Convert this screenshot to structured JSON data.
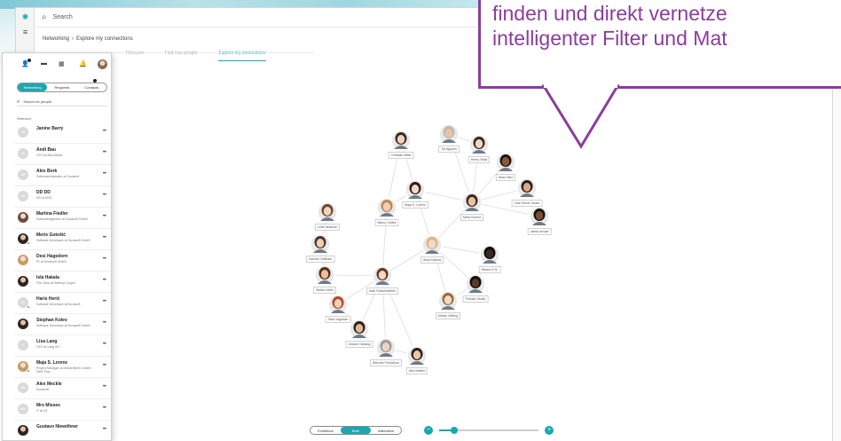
{
  "header": {
    "search_placeholder": "Search",
    "breadcrumb": [
      "Networking",
      "Explore my connections"
    ],
    "tabs": [
      {
        "label": "Relevant",
        "active": false
      },
      {
        "label": "Find new people",
        "active": false
      },
      {
        "label": "Explore my connections",
        "active": true
      }
    ]
  },
  "left_panel": {
    "segments": [
      {
        "label": "Networking",
        "active": true
      },
      {
        "label": "Requests",
        "active": false
      },
      {
        "label": "Contacts",
        "active": false
      }
    ],
    "search_placeholder": "Search for people",
    "section_label": "Relevant",
    "people": [
      {
        "name": "Janine Barry",
        "title": "",
        "initials": "JB",
        "photo": "",
        "online": false
      },
      {
        "name": "Andi Bau",
        "title": "CEO at Bau Media",
        "initials": "AB",
        "photo": "",
        "online": false
      },
      {
        "name": "Alex Bork",
        "title": "Softwareentwickler at Dovasoft",
        "initials": "AB",
        "photo": "",
        "online": false
      },
      {
        "name": "DD DD",
        "title": "DD at DDD",
        "initials": "DD",
        "photo": "",
        "online": false
      },
      {
        "name": "Martina Fiedler",
        "title": "Softwareingenieur at Dovasoft GmbH",
        "initials": "",
        "photo": "photo",
        "online": false
      },
      {
        "name": "Meris Gutošić",
        "title": "Software Developer at Dovasoft GmbH",
        "initials": "",
        "photo": "photo2",
        "online": true
      },
      {
        "name": "Desi Hagedorn",
        "title": "PL at Dovasoft GmbH",
        "initials": "",
        "photo": "photo3",
        "online": false
      },
      {
        "name": "Isla Hakala",
        "title": "File Clerk at Starling Cooper",
        "initials": "",
        "photo": "photo2",
        "online": false
      },
      {
        "name": "Haris Herić",
        "title": "Software Developer at Dovasoft",
        "initials": "HH",
        "photo": "",
        "online": true
      },
      {
        "name": "Stephan Kolev",
        "title": "Software Developer at Dovasoft GmbH",
        "initials": "",
        "photo": "photo2",
        "online": false
      },
      {
        "name": "Lisa Lang",
        "title": "CEO at Lang AG",
        "initials": "LL",
        "photo": "",
        "online": false
      },
      {
        "name": "Maja S. Lorenz",
        "title": "Project Manager at Medai Berlin GmbH / DMS Plus",
        "initials": "",
        "photo": "photo3",
        "online": true
      },
      {
        "name": "Alex Meckle",
        "title": "Dovasoft",
        "initials": "AM",
        "photo": "",
        "online": false
      },
      {
        "name": "Mrs Misses",
        "title": "IT at Ctl",
        "initials": "MM",
        "photo": "",
        "online": false
      },
      {
        "name": "Gustavo Niewöhner",
        "title": "",
        "initials": "",
        "photo": "photo2",
        "online": false
      }
    ]
  },
  "network": {
    "nodes": [
      {
        "label": "Christian Miller",
        "skin": "#f0d3bd",
        "hair": "#3a2a20"
      },
      {
        "label": "Tia Nguyen",
        "skin": "#e7c3a4",
        "hair": "#b9b9b9"
      },
      {
        "label": "Henry Tesla",
        "skin": "#f1d6c2",
        "hair": "#3b2a20"
      },
      {
        "label": "Akan Tako",
        "skin": "#8a5a3c",
        "hair": "#1c1410"
      },
      {
        "label": "José Sinclo Studio",
        "skin": "#d8a982",
        "hair": "#2a1d15"
      },
      {
        "label": "Jamal Arruda",
        "skin": "#7a4f35",
        "hair": "#1a120d"
      },
      {
        "label": "Maja S. Lorenz",
        "skin": "#f2d8c4",
        "hair": "#2d1e15"
      },
      {
        "label": "Marco Guttek",
        "skin": "#f0cfb4",
        "hair": "#b88a57"
      },
      {
        "label": "Mirta Gomez",
        "skin": "#e8c3a2",
        "hair": "#3d2a1c"
      },
      {
        "label": "Leila Newman",
        "skin": "#f1d4bd",
        "hair": "#6b4a2f"
      },
      {
        "label": "Carmen Hoffman",
        "skin": "#f0d0b8",
        "hair": "#4d3526"
      },
      {
        "label": "Anna Kaszta",
        "skin": "#f3dbc9",
        "hair": "#d8b77f"
      },
      {
        "label": "Weson D.N.",
        "skin": "#3a2a22",
        "hair": "#0f0b09"
      },
      {
        "label": "Stefan Keller",
        "skin": "#e9bfa0",
        "hair": "#5a2e1c"
      },
      {
        "label": "Kate Rosenblättner",
        "skin": "#f1d6c4",
        "hair": "#5c3a25"
      },
      {
        "label": "Praslan Studio",
        "skin": "#5c3a27",
        "hair": "#150f0b"
      },
      {
        "label": "Silva Vogelsen",
        "skin": "#f0cfb6",
        "hair": "#b04a2d"
      },
      {
        "label": "Maxim Weling",
        "skin": "#f2d8c6",
        "hair": "#9a6a3d"
      },
      {
        "label": "Johann Garlang",
        "skin": "#e2b896",
        "hair": "#2d2018"
      },
      {
        "label": "Wencke Poerivlirou",
        "skin": "#f0d4c0",
        "hair": "#9a9a9a"
      },
      {
        "label": "Alex Mettler",
        "skin": "#e9c6ab",
        "hair": "#2c1f17"
      }
    ]
  },
  "bottom": {
    "segments": [
      {
        "label": "Exhibitors",
        "active": false
      },
      {
        "label": "Both",
        "active": true
      },
      {
        "label": "Attendees",
        "active": false
      }
    ],
    "zoom_minus": "−",
    "zoom_plus": "+",
    "zoom_level": 0.15
  },
  "callout": {
    "lines": [
      "finden und direkt vernetze",
      "intelligenter Filter und Mat"
    ],
    "color": "#8b3d9c"
  },
  "colors": {
    "accent": "#1aa7b0"
  }
}
